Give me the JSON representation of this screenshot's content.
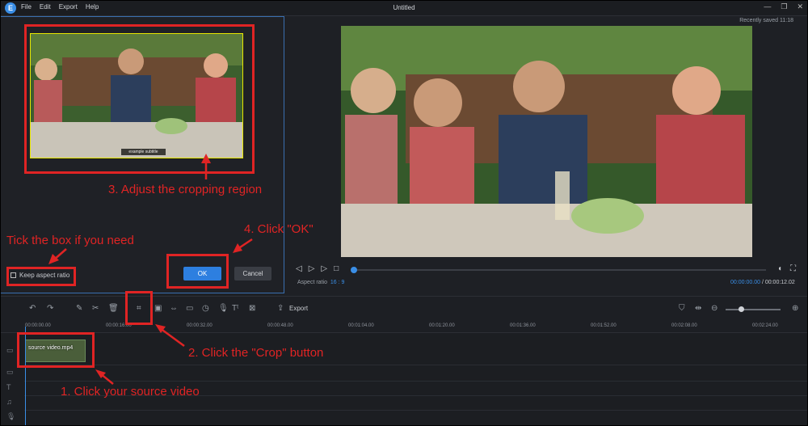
{
  "app": {
    "logo": "E",
    "title": "Untitled",
    "saved": "Recently saved 11:18"
  },
  "menu": [
    "File",
    "Edit",
    "Export",
    "Help"
  ],
  "window_controls": {
    "minimize": "—",
    "restore": "❐",
    "close": "✕"
  },
  "crop_dialog": {
    "keep_aspect_label": "Keep aspect ratio",
    "ok_label": "OK",
    "cancel_label": "Cancel",
    "clip_caption": "example subtitle"
  },
  "preview": {
    "aspect_label": "Aspect ratio",
    "aspect_value": "16 : 9",
    "current_time": "00:00:00.00",
    "total_time": "/ 00:00:12.02"
  },
  "toolbar": {
    "export_label": "Export"
  },
  "ruler": [
    "00:00:00.00",
    "00:00:16.00",
    "00:00:32.00",
    "00:00:48.00",
    "00:01:04.00",
    "00:01:20.00",
    "00:01:36.00",
    "00:01:52.00",
    "00:02:08.00",
    "00:02:24.00"
  ],
  "timeline": {
    "clip_name": "source video.mp4"
  },
  "annotations": {
    "step1": "1. Click your source video",
    "step2": "2. Click the \"Crop\" button",
    "step3": "3. Adjust the cropping region",
    "step4": "4. Click \"OK\"",
    "tick": "Tick the box if you need"
  },
  "colors": {
    "accent": "#2d7fe0",
    "annotation": "#e02424",
    "crop_frame": "#e6e600"
  }
}
